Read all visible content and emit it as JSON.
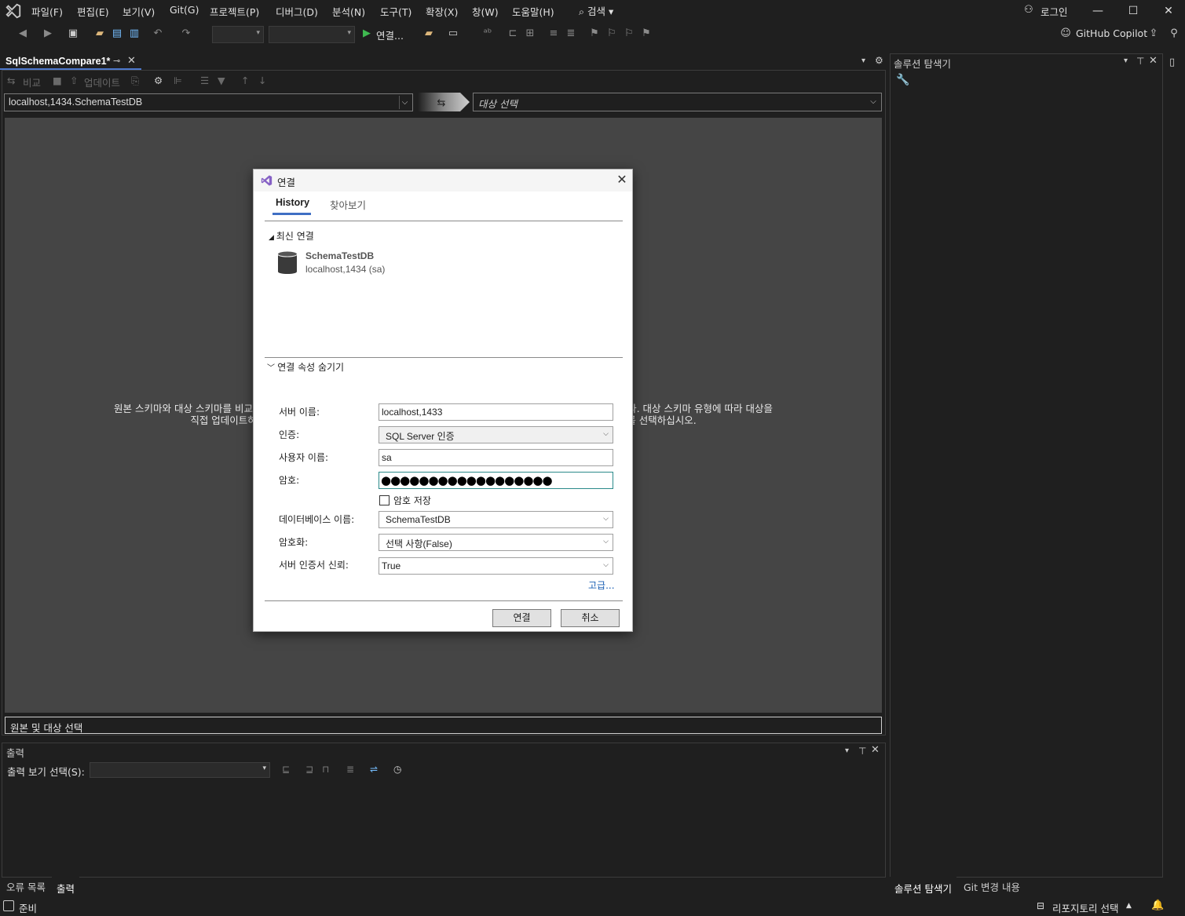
{
  "menu": {
    "items": [
      "파일(F)",
      "편집(E)",
      "보기(V)",
      "Git(G)",
      "프로젝트(P)",
      "디버그(D)",
      "분석(N)",
      "도구(T)",
      "확장(X)",
      "창(W)",
      "도움말(H)"
    ],
    "search": "⌕ 검색 ▾",
    "login": "로그인"
  },
  "toolbar": {
    "run_label": "연결...",
    "copilot": "GitHub Copilot"
  },
  "document": {
    "tab_title": "SqlSchemaCompare1*",
    "toolbar": {
      "compare": "비교",
      "update": "업데이트"
    },
    "source": "localhost,1434.SchemaTestDB",
    "target_placeholder": "대상 선택",
    "info_line1": "원본 스키마와 대상 스키마를 비교하여 차이를 확인할 수 있습니다. 그런 다음 원본과 일치하도록 대상을 업데이트할 수 있습니다. 대상 스키마 유형에 따라 대상을",
    "info_line2": "직접 업데이트하거나 업데이트 스크립트를 생성할 수 있습니다. 시작하려면 원본과 대상을 선택한 후 [비교]를 선택하십시오.",
    "status": "원본 및 대상 선택"
  },
  "solution_explorer": {
    "title": "솔루션 탐색기"
  },
  "output": {
    "title": "출력",
    "select_label": "출력 보기 선택(S):"
  },
  "bottom_tabs": {
    "left": [
      "오류 목록",
      "출력"
    ],
    "right": [
      "솔루션 탐색기",
      "Git 변경 내용"
    ]
  },
  "statusbar": {
    "ready": "준비",
    "repo": "리포지토리 선택"
  },
  "dialog": {
    "title": "연결",
    "tabs": [
      "History",
      "찾아보기"
    ],
    "recent_header": "최신 연결",
    "recent": {
      "name": "SchemaTestDB",
      "sub": "localhost,1434 (sa)"
    },
    "props_toggle": "연결 속성 숨기기",
    "fields": {
      "server_label": "서버 이름:",
      "server_value": "localhost,1433",
      "auth_label": "인증:",
      "auth_value": "SQL Server 인증",
      "user_label": "사용자 이름:",
      "user_value": "sa",
      "password_label": "암호:",
      "password_value": "●●●●●●●●●●●●●●●●●●",
      "save_password": "암호 저장",
      "database_label": "데이터베이스 이름:",
      "database_value": "SchemaTestDB",
      "encrypt_label": "암호화:",
      "encrypt_value": "선택 사항(False)",
      "trust_label": "서버 인증서 신뢰:",
      "trust_value": "True"
    },
    "advanced": "고급...",
    "connect_button": "연결",
    "cancel_button": "취소"
  },
  "colors": {
    "accent": "#4d78cc",
    "panel_bg": "#1f1f1f",
    "compare_area": "#454545",
    "vs_purple": "#8661c5"
  }
}
